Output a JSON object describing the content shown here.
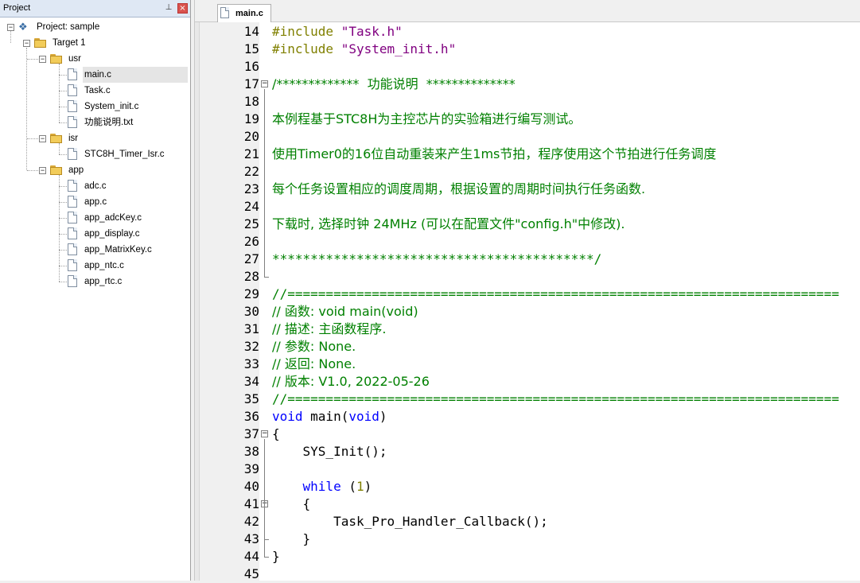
{
  "project_panel": {
    "title": "Project",
    "pin_glyph": "ᵖ",
    "close_glyph": "×",
    "tree": {
      "project": "Project: sample",
      "target": "Target 1",
      "groups": [
        {
          "name": "usr",
          "files": [
            "main.c",
            "Task.c",
            "System_init.c",
            "功能说明.txt"
          ]
        },
        {
          "name": "isr",
          "files": [
            "STC8H_Timer_Isr.c"
          ]
        },
        {
          "name": "app",
          "files": [
            "adc.c",
            "app.c",
            "app_adcKey.c",
            "app_display.c",
            "app_MatrixKey.c",
            "app_ntc.c",
            "app_rtc.c"
          ]
        }
      ],
      "selected_file": "main.c"
    }
  },
  "editor": {
    "active_tab": "main.c",
    "lines": [
      {
        "n": "14",
        "parts": [
          [
            "#include ",
            "olive"
          ],
          [
            "\"Task.h\"",
            "purple"
          ]
        ]
      },
      {
        "n": "15",
        "parts": [
          [
            "#include ",
            "olive"
          ],
          [
            "\"System_init.h\"",
            "purple"
          ]
        ]
      },
      {
        "n": "16",
        "parts": []
      },
      {
        "n": "17",
        "fold": "open",
        "parts": [
          [
            "/*************  功能说明  **************",
            "green"
          ]
        ]
      },
      {
        "n": "18",
        "parts": []
      },
      {
        "n": "19",
        "parts": [
          [
            "本例程基于STC8H为主控芯片的实验箱进行编写测试。",
            "green"
          ]
        ]
      },
      {
        "n": "20",
        "parts": []
      },
      {
        "n": "21",
        "parts": [
          [
            "使用Timer0的16位自动重装来产生1ms节拍，程序使用这个节拍进行任务调度",
            "green"
          ]
        ]
      },
      {
        "n": "22",
        "parts": []
      },
      {
        "n": "23",
        "parts": [
          [
            "每个任务设置相应的调度周期，根据设置的周期时间执行任务函数.",
            "green"
          ]
        ]
      },
      {
        "n": "24",
        "parts": []
      },
      {
        "n": "25",
        "parts": [
          [
            "下载时, 选择时钟 24MHz (可以在配置文件\"config.h\"中修改).",
            "green"
          ]
        ]
      },
      {
        "n": "26",
        "parts": []
      },
      {
        "n": "27",
        "parts": [
          [
            "******************************************/",
            "green"
          ]
        ]
      },
      {
        "n": "28",
        "fold": "end",
        "parts": []
      },
      {
        "n": "29",
        "parts": [
          [
            "//========================================================================",
            "green"
          ]
        ]
      },
      {
        "n": "30",
        "parts": [
          [
            "// 函数: void main(void)",
            "green"
          ]
        ]
      },
      {
        "n": "31",
        "parts": [
          [
            "// 描述: 主函数程序.",
            "green"
          ]
        ]
      },
      {
        "n": "32",
        "parts": [
          [
            "// 参数: None.",
            "green"
          ]
        ]
      },
      {
        "n": "33",
        "parts": [
          [
            "// 返回: None.",
            "green"
          ]
        ]
      },
      {
        "n": "34",
        "parts": [
          [
            "// 版本: V1.0, 2022-05-26",
            "green"
          ]
        ]
      },
      {
        "n": "35",
        "parts": [
          [
            "//========================================================================",
            "green"
          ]
        ]
      },
      {
        "n": "36",
        "parts": [
          [
            "void",
            "blue"
          ],
          [
            " main(",
            "black"
          ],
          [
            "void",
            "blue"
          ],
          [
            ")",
            "black"
          ]
        ]
      },
      {
        "n": "37",
        "fold": "open",
        "parts": [
          [
            "{",
            "black"
          ]
        ]
      },
      {
        "n": "38",
        "parts": [
          [
            "    SYS_Init();",
            "black"
          ]
        ]
      },
      {
        "n": "39",
        "parts": []
      },
      {
        "n": "40",
        "parts": [
          [
            "    ",
            "black"
          ],
          [
            "while",
            "blue"
          ],
          [
            " (",
            "black"
          ],
          [
            "1",
            "num"
          ],
          [
            ")",
            "black"
          ]
        ]
      },
      {
        "n": "41",
        "fold": "open",
        "parts": [
          [
            "    {",
            "black"
          ]
        ]
      },
      {
        "n": "42",
        "parts": [
          [
            "        Task_Pro_Handler_Callback();",
            "black"
          ]
        ]
      },
      {
        "n": "43",
        "fold": "end",
        "parts": [
          [
            "    }",
            "black"
          ]
        ]
      },
      {
        "n": "44",
        "fold": "end",
        "parts": [
          [
            "}",
            "black"
          ]
        ]
      },
      {
        "n": "45",
        "parts": []
      }
    ]
  },
  "colors": {
    "comment": "#008000",
    "preprocessor": "#808000",
    "string": "#800080",
    "keyword": "#0000ff"
  }
}
